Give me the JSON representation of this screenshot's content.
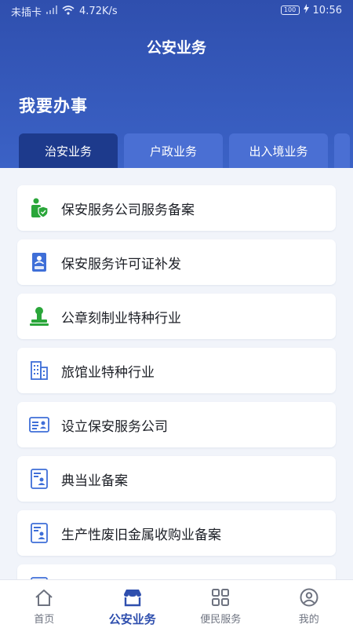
{
  "status_bar": {
    "carrier": "未插卡",
    "speed": "4.72K/s",
    "battery": "100",
    "time": "10:56"
  },
  "header": {
    "title": "公安业务",
    "section_title": "我要办事"
  },
  "tabs": [
    {
      "label": "治安业务",
      "active": true
    },
    {
      "label": "户政业务",
      "active": false
    },
    {
      "label": "出入境业务",
      "active": false
    }
  ],
  "items": [
    {
      "label": "保安服务公司服务备案",
      "icon": "person-shield-icon"
    },
    {
      "label": "保安服务许可证补发",
      "icon": "license-card-icon"
    },
    {
      "label": "公章刻制业特种行业",
      "icon": "stamp-icon"
    },
    {
      "label": "旅馆业特种行业",
      "icon": "building-icon"
    },
    {
      "label": "设立保安服务公司",
      "icon": "id-card-icon"
    },
    {
      "label": "典当业备案",
      "icon": "document-person-icon"
    },
    {
      "label": "生产性废旧金属收购业备案",
      "icon": "document-person-icon"
    }
  ],
  "bottom_nav": [
    {
      "label": "首页",
      "icon": "home-icon",
      "active": false
    },
    {
      "label": "公安业务",
      "icon": "store-icon",
      "active": true
    },
    {
      "label": "便民服务",
      "icon": "grid-icon",
      "active": false
    },
    {
      "label": "我的",
      "icon": "user-icon",
      "active": false
    }
  ],
  "colors": {
    "primary": "#2f4fae",
    "tab_active": "#1d3a8c",
    "tab_inactive": "#4a6fd3",
    "icon_blue": "#3f6fd8",
    "icon_green": "#2aa63a"
  }
}
